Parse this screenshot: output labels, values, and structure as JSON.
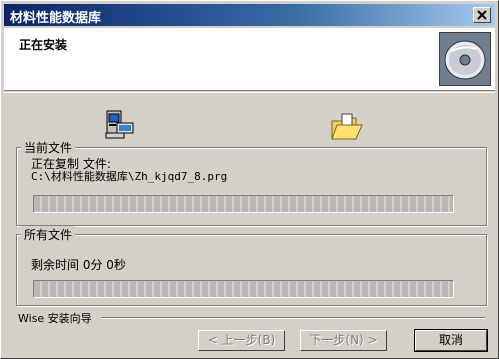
{
  "window": {
    "title": "材料性能数据库"
  },
  "header": {
    "title": "正在安装"
  },
  "current_file": {
    "label": "当前文件",
    "status": "正在复制 文件:",
    "path": "C:\\材料性能数据库\\Zh_kjqd7_8.prg",
    "progress": 0
  },
  "all_files": {
    "label": "所有文件",
    "remaining": "剩余时间 0分 0秒",
    "progress": 0
  },
  "footer": {
    "wizard_label": "Wise 安装向导"
  },
  "buttons": {
    "back": "< 上一步(B)",
    "next": "下一步(N) >",
    "cancel": "取消"
  }
}
